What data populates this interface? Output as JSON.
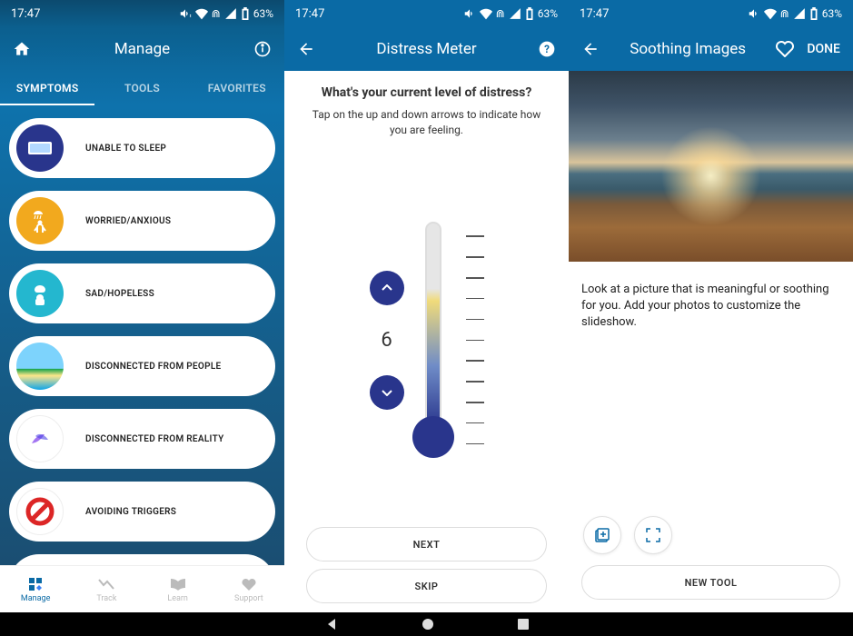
{
  "status": {
    "time": "17:47",
    "battery": "63%"
  },
  "screen1": {
    "title": "Manage",
    "tabs": [
      "SYMPTOMS",
      "TOOLS",
      "FAVORITES"
    ],
    "active_tab": 0,
    "symptoms": [
      {
        "label": "UNABLE TO SLEEP",
        "bg": "#29358c",
        "emoji": "pillow"
      },
      {
        "label": "WORRIED/ANXIOUS",
        "bg": "#f2a91e",
        "emoji": "rain-person"
      },
      {
        "label": "SAD/HOPELESS",
        "bg": "#24b7cf",
        "emoji": "sad-cloud"
      },
      {
        "label": "DISCONNECTED FROM PEOPLE",
        "bg": "#7ed0c9",
        "emoji": "beach"
      },
      {
        "label": "DISCONNECTED FROM REALITY",
        "bg": "#ffffff",
        "emoji": "abstract"
      },
      {
        "label": "AVOIDING TRIGGERS",
        "bg": "#ffffff",
        "emoji": "no-sign"
      }
    ],
    "bottom_nav": [
      {
        "label": "Manage",
        "icon": "grid"
      },
      {
        "label": "Track",
        "icon": "trend"
      },
      {
        "label": "Learn",
        "icon": "book"
      },
      {
        "label": "Support",
        "icon": "heart"
      }
    ],
    "active_bottom": 0
  },
  "screen2": {
    "title": "Distress Meter",
    "question": "What's your current level of distress?",
    "subtitle": "Tap on the up and down arrows to indicate how you are feeling.",
    "value": "6",
    "next_label": "NEXT",
    "skip_label": "SKIP"
  },
  "screen3": {
    "title": "Soothing Images",
    "done_label": "DONE",
    "description": "Look at a picture that is meaningful or soothing for you. Add your photos to customize the slideshow.",
    "new_tool_label": "NEW TOOL"
  }
}
